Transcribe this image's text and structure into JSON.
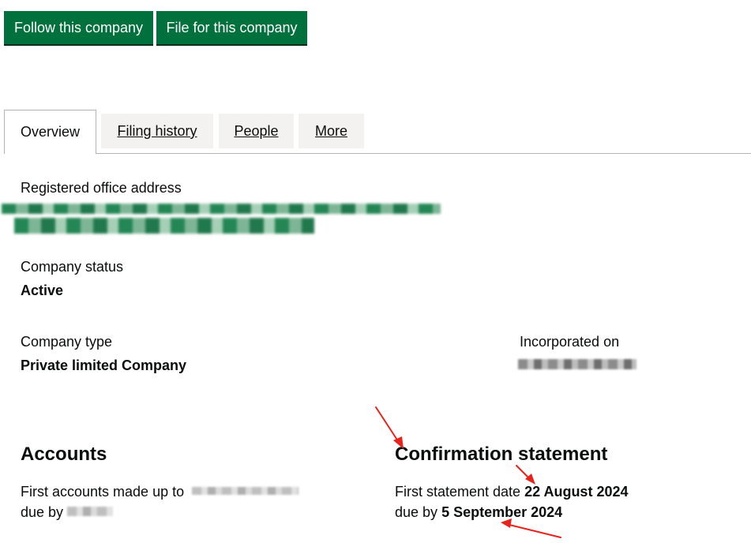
{
  "actions": {
    "follow_label": "Follow this company",
    "file_label": "File for this company"
  },
  "tabs": [
    {
      "label": "Overview",
      "active": true
    },
    {
      "label": "Filing history",
      "active": false
    },
    {
      "label": "People",
      "active": false
    },
    {
      "label": "More",
      "active": false
    }
  ],
  "overview": {
    "registered_office_label": "Registered office address",
    "company_status_label": "Company status",
    "company_status_value": "Active",
    "company_type_label": "Company type",
    "company_type_value": "Private limited Company",
    "incorporated_label": "Incorporated on"
  },
  "accounts": {
    "heading": "Accounts",
    "first_accounts_prefix": "First accounts made up to",
    "due_by_prefix": "due by"
  },
  "confirmation": {
    "heading": "Confirmation statement",
    "first_statement_prefix": "First statement date",
    "first_statement_date": "22 August 2024",
    "due_by_prefix": "due by",
    "due_by_date": "5 September 2024"
  },
  "colors": {
    "button_green": "#00703c",
    "annotation_red": "#e8231b"
  }
}
